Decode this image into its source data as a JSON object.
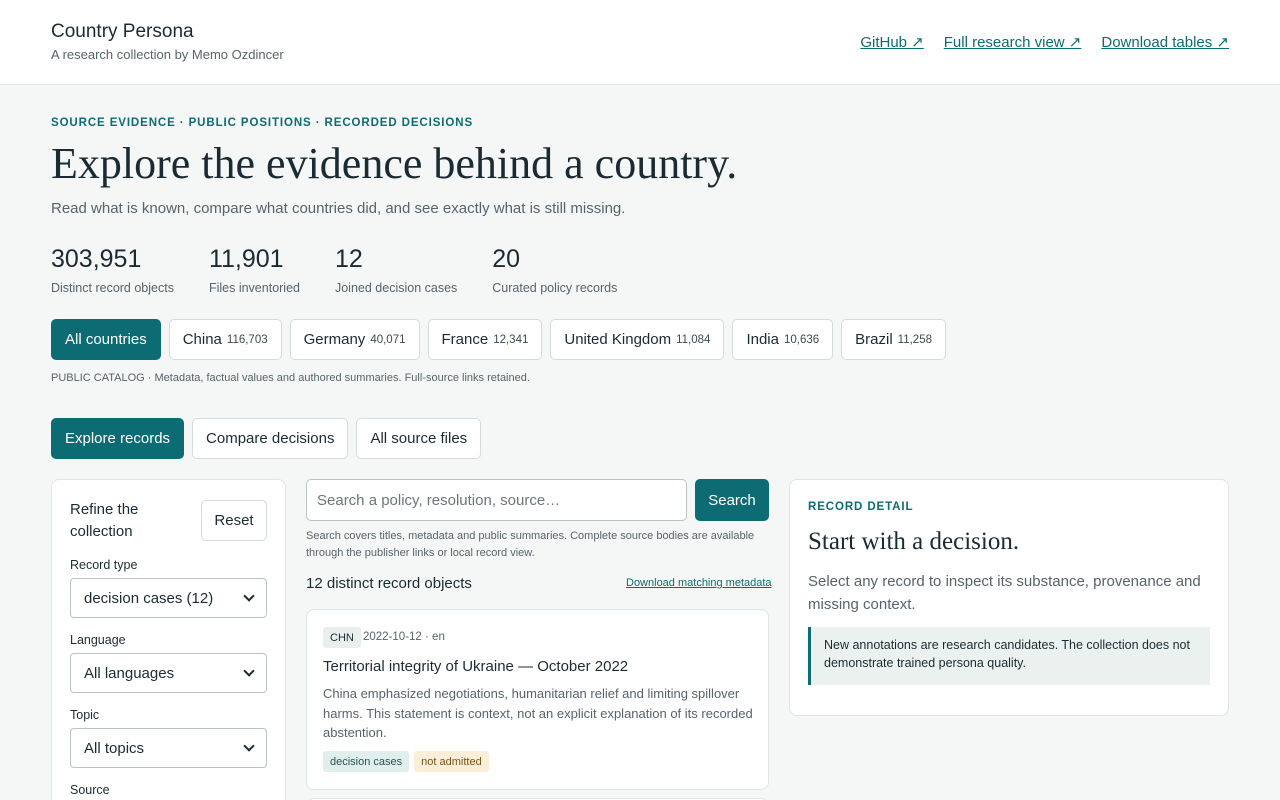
{
  "header": {
    "title": "Country Persona",
    "subtitle": "A research collection by Memo Ozdincer",
    "links": [
      "GitHub ↗",
      "Full research view ↗",
      "Download tables ↗"
    ]
  },
  "hero": {
    "eyebrow": "SOURCE EVIDENCE · PUBLIC POSITIONS · RECORDED DECISIONS",
    "title": "Explore the evidence behind a country.",
    "subtitle": "Read what is known, compare what countries did, and see exactly what is still missing."
  },
  "stats": [
    {
      "value": "303,951",
      "label": "Distinct record objects"
    },
    {
      "value": "11,901",
      "label": "Files inventoried"
    },
    {
      "value": "12",
      "label": "Joined decision cases"
    },
    {
      "value": "20",
      "label": "Curated policy records"
    }
  ],
  "countries": [
    {
      "name": "All countries",
      "count": ""
    },
    {
      "name": "China",
      "count": "116,703"
    },
    {
      "name": "Germany",
      "count": "40,071"
    },
    {
      "name": "France",
      "count": "12,341"
    },
    {
      "name": "United Kingdom",
      "count": "11,084"
    },
    {
      "name": "India",
      "count": "10,636"
    },
    {
      "name": "Brazil",
      "count": "11,258"
    }
  ],
  "catalog_note": "PUBLIC CATALOG · Metadata, factual values and authored summaries. Full-source links retained.",
  "view_tabs": [
    "Explore records",
    "Compare decisions",
    "All source files"
  ],
  "filters": {
    "title": "Refine the collection",
    "reset_label": "Reset",
    "record_type_label": "Record type",
    "record_type_value": "decision cases (12)",
    "language_label": "Language",
    "language_value": "All languages",
    "topic_label": "Topic",
    "topic_value": "All topics",
    "source_label": "Source"
  },
  "search": {
    "placeholder": "Search a policy, resolution, source…",
    "button_label": "Search",
    "note": "Search covers titles, metadata and public summaries. Complete source bodies are available through the publisher links or local record view."
  },
  "results": {
    "count_label": "12 distinct record objects",
    "download_label": "Download matching metadata",
    "records": [
      {
        "code": "CHN",
        "meta": "2022-10-12 · en",
        "title": "Territorial integrity of Ukraine — October 2022",
        "summary": "China emphasized negotiations, humanitarian relief and limiting spillover harms. This statement is context, not an explicit explanation of its recorded abstention.",
        "tags": [
          "decision cases",
          "not admitted"
        ]
      }
    ]
  },
  "detail": {
    "eyebrow": "RECORD DETAIL",
    "title": "Start with a decision.",
    "body": "Select any record to inspect its substance, provenance and missing context.",
    "note": "New annotations are research candidates. The collection does not demonstrate trained persona quality."
  }
}
